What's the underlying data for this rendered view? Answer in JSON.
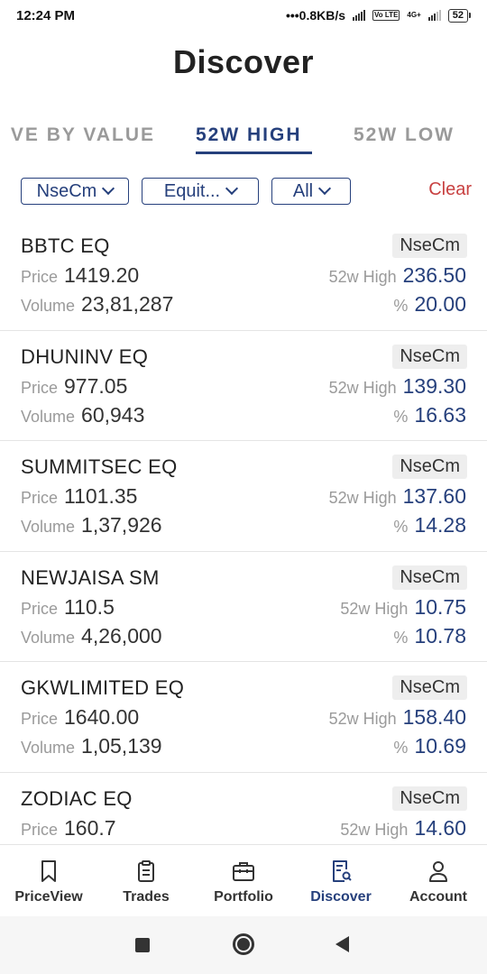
{
  "status_bar": {
    "time": "12:24 PM",
    "net_speed": "0.8KB/s",
    "lte": "Vo LTE",
    "network": "4G+",
    "battery": "52"
  },
  "page": {
    "title": "Discover"
  },
  "tabs": [
    {
      "label": "VE BY VALUE",
      "active": false
    },
    {
      "label": "52W HIGH",
      "active": true
    },
    {
      "label": "52W LOW",
      "active": false
    }
  ],
  "filters": {
    "exchange": "NseCm",
    "segment": "Equit...",
    "group": "All",
    "clear_label": "Clear"
  },
  "labels": {
    "price": "Price",
    "volume": "Volume",
    "high": "52w High",
    "pct": "%"
  },
  "stocks": [
    {
      "symbol": "BBTC EQ",
      "exchange": "NseCm",
      "price": "1419.20",
      "volume": "23,81,287",
      "high": "236.50",
      "pct": "20.00"
    },
    {
      "symbol": "DHUNINV EQ",
      "exchange": "NseCm",
      "price": "977.05",
      "volume": "60,943",
      "high": "139.30",
      "pct": "16.63"
    },
    {
      "symbol": "SUMMITSEC EQ",
      "exchange": "NseCm",
      "price": "1101.35",
      "volume": "1,37,926",
      "high": "137.60",
      "pct": "14.28"
    },
    {
      "symbol": "NEWJAISA SM",
      "exchange": "NseCm",
      "price": "110.5",
      "volume": "4,26,000",
      "high": "10.75",
      "pct": "10.78"
    },
    {
      "symbol": "GKWLIMITED EQ",
      "exchange": "NseCm",
      "price": "1640.00",
      "volume": "1,05,139",
      "high": "158.40",
      "pct": "10.69"
    },
    {
      "symbol": "ZODIAC EQ",
      "exchange": "NseCm",
      "price": "160.7",
      "high": "14.60"
    }
  ],
  "bottom_nav": [
    {
      "label": "PriceView",
      "icon": "bookmark-icon",
      "active": false
    },
    {
      "label": "Trades",
      "icon": "clipboard-icon",
      "active": false
    },
    {
      "label": "Portfolio",
      "icon": "briefcase-icon",
      "active": false
    },
    {
      "label": "Discover",
      "icon": "document-search-icon",
      "active": true
    },
    {
      "label": "Account",
      "icon": "user-icon",
      "active": false
    }
  ],
  "colors": {
    "accent": "#26407c",
    "clear": "#c84141",
    "muted": "#9a9a9a"
  }
}
